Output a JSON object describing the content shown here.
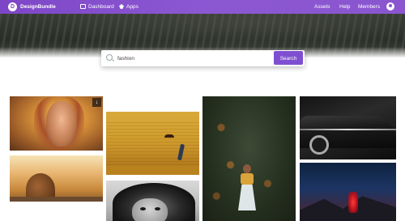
{
  "nav": {
    "brand": "DesignBundle",
    "logo_letter": "D",
    "items": [
      {
        "label": "Dashboard",
        "icon": "dashboard-icon"
      },
      {
        "label": "Apps",
        "icon": "apps-icon"
      }
    ],
    "right_items": [
      "Assets",
      "Help",
      "Members"
    ],
    "user_icon": "user-icon",
    "accent": "#7e4fd0"
  },
  "search": {
    "value": "fashion",
    "button_label": "Search",
    "icon": "search-icon"
  },
  "gallery": {
    "badge_text": "↓"
  }
}
